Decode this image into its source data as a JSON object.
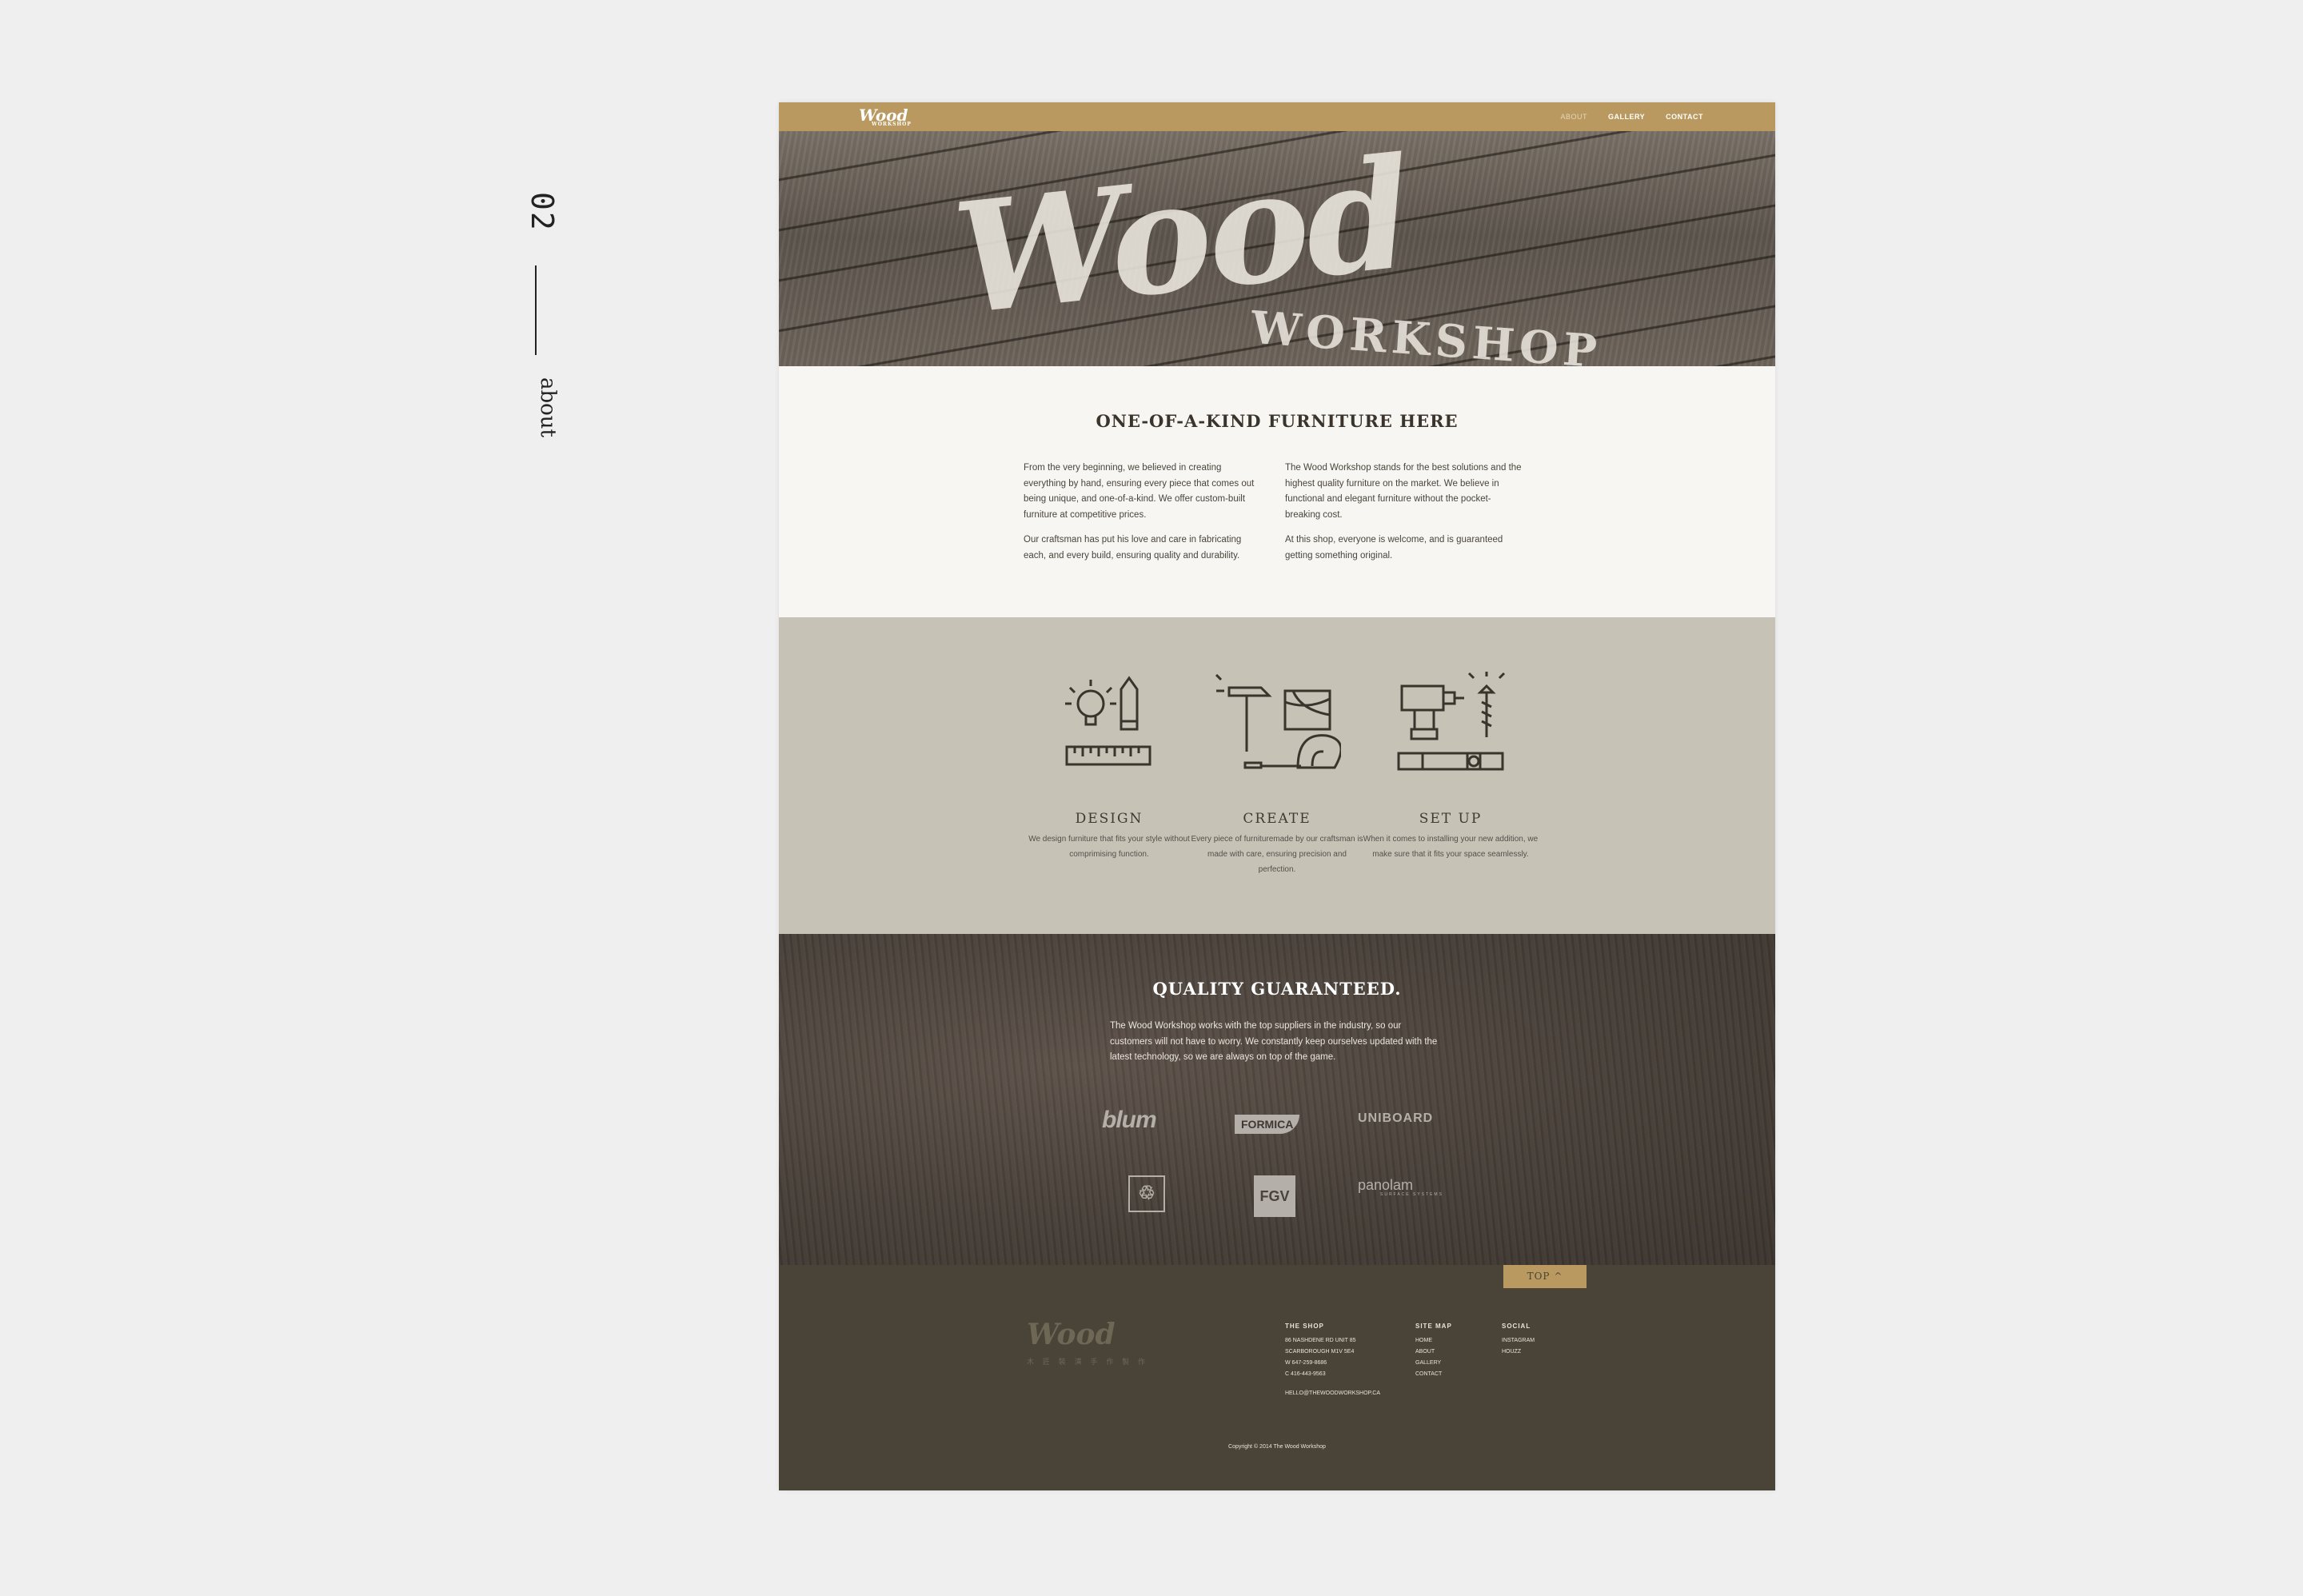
{
  "side": {
    "number": "02",
    "label": "about"
  },
  "header": {
    "logo": "Wood",
    "logo_sub": "WORKSHOP",
    "nav": [
      "ABOUT",
      "GALLERY",
      "CONTACT"
    ]
  },
  "hero": {
    "word": "Wood",
    "sub": "WORKSHOP"
  },
  "intro": {
    "title": "ONE-OF-A-KIND FURNITURE HERE",
    "left": [
      "From the very beginning, we believed in creating everything by hand, ensuring every piece that comes out being unique, and one-of-a-kind. We offer custom-built furniture at competitive prices.",
      "Our craftsman has put his love and care in fabricating each, and every build, ensuring quality and durability."
    ],
    "right": [
      "The Wood Workshop stands for the best solutions and the highest quality furniture on the market. We believe in functional and elegant furniture without the pocket-breaking cost.",
      "At this shop, everyone is welcome, and is guaranteed getting something original."
    ]
  },
  "services": [
    {
      "icon": "design-tools-icon",
      "title": "DESIGN",
      "text": "We design furniture that fits your style without comprimising function."
    },
    {
      "icon": "hammer-tools-icon",
      "title": "CREATE",
      "text": "Every piece of furnituremade by our craftsman is made with care, ensuring precision and perfection."
    },
    {
      "icon": "drill-tools-icon",
      "title": "SET UP",
      "text": "When it comes to installing your new addition, we make sure that it fits your space seamlessly."
    }
  ],
  "quality": {
    "title": "QUALITY GUARANTEED.",
    "text": "The Wood Workshop works with the top suppliers in the industry, so our customers will not have to worry. We constantly keep ourselves updated with the latest technology, so we are always on top of the game.",
    "brands": [
      "blum",
      "FORMICA",
      "UNIBOARD",
      "panolam"
    ],
    "panolam_sub": "SURFACE SYSTEMS",
    "fgv": "FGV"
  },
  "footer": {
    "top_button": "TOP ^",
    "logo": "Wood",
    "logo_sub": "木 匠 裝 潢 手 作 製 作",
    "shop": {
      "heading": "THE SHOP",
      "lines": [
        "86 NASHDENE RD     UNIT 85",
        "SCARBOROUGH     M1V 5E4",
        "W     647-259-8686",
        "C     416-443-9563"
      ],
      "email": "HELLO@THEWOODWORKSHOP.CA"
    },
    "sitemap": {
      "heading": "SITE MAP",
      "items": [
        "HOME",
        "ABOUT",
        "GALLERY",
        "CONTACT"
      ]
    },
    "social": {
      "heading": "SOCIAL",
      "items": [
        "INSTAGRAM",
        "HOUZZ"
      ]
    },
    "copyright": "Copyright © 2014 The Wood Workshop"
  },
  "colors": {
    "gold": "#b9995f",
    "services_bg": "#c6c2b6",
    "footer_bg": "#4a4337",
    "page_bg": "#f7f6f2"
  }
}
